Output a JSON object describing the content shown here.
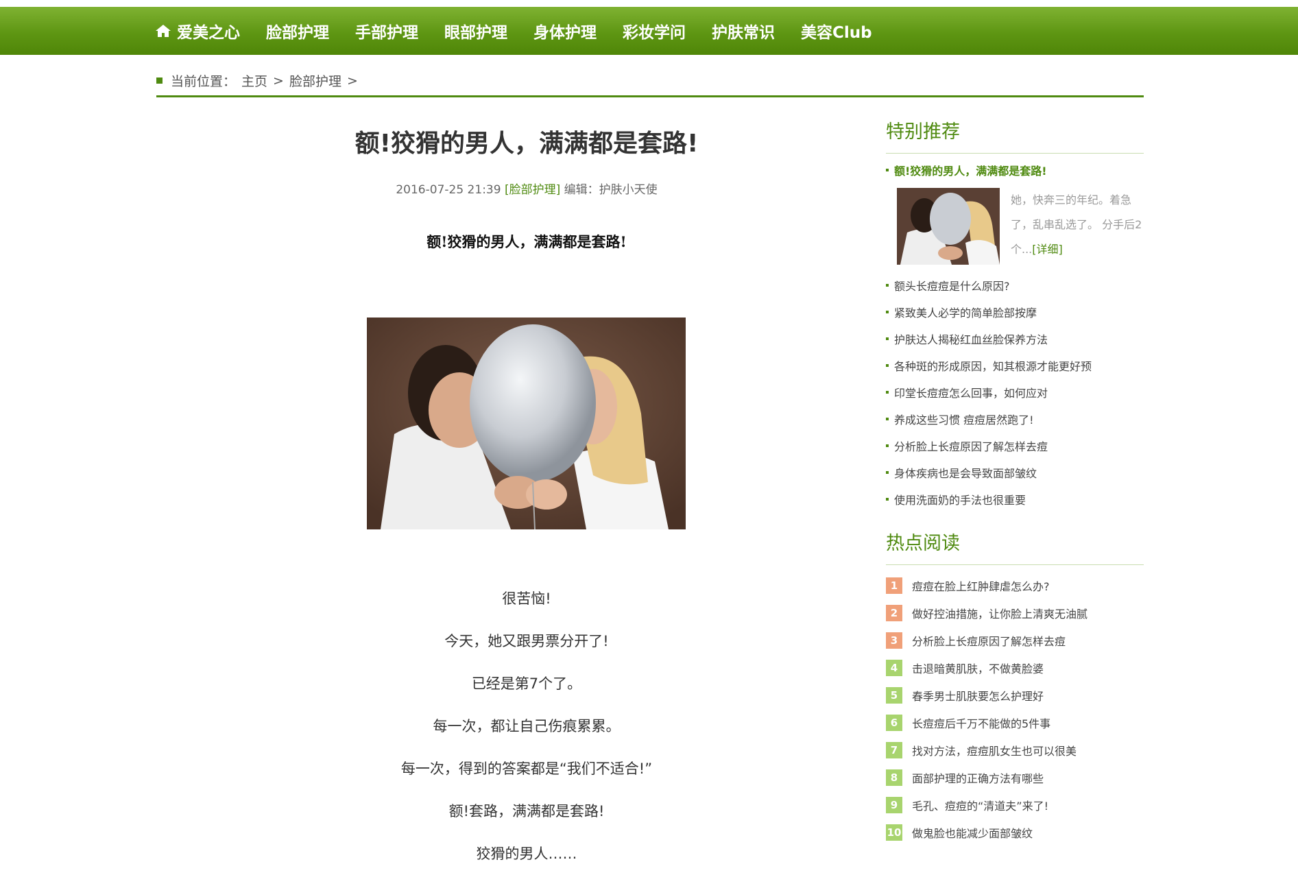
{
  "nav": {
    "home": "爱美之心",
    "items": [
      "脸部护理",
      "手部护理",
      "眼部护理",
      "身体护理",
      "彩妆学问",
      "护肤常识",
      "美容Club"
    ]
  },
  "breadcrumb": {
    "label": "当前位置：",
    "home": "主页",
    "sep1": ">",
    "category": "脸部护理",
    "sep2": ">"
  },
  "article": {
    "title": "额!狡猾的男人，满满都是套路!",
    "datetime": "2016-07-25 21:39",
    "category": "[脸部护理]",
    "editor": "编辑：护肤小天使",
    "subtitle": "额!狡猾的男人，满满都是套路!",
    "paragraphs": [
      "很苦恼!",
      "今天，她又跟男票分开了!",
      "已经是第7个了。",
      "每一次，都让自己伤痕累累。",
      "每一次，得到的答案都是“我们不适合!”",
      "额!套路，满满都是套路!",
      "狡猾的男人……"
    ]
  },
  "recommend": {
    "heading": "特别推荐",
    "featured_title": "额!狡猾的男人，满满都是套路!",
    "featured_desc": "她，快奔三的年纪。着急了，乱串乱选了。 分手后2个...",
    "featured_more": "[详细]",
    "items": [
      "额头长痘痘是什么原因?",
      "紧致美人必学的简单脸部按摩",
      "护肤达人揭秘红血丝脸保养方法",
      "各种斑的形成原因，知其根源才能更好预",
      "印堂长痘痘怎么回事，如何应对",
      "养成这些习惯 痘痘居然跑了!",
      "分析脸上长痘原因了解怎样去痘",
      "身体疾病也是会导致面部皱纹",
      "使用洗面奶的手法也很重要"
    ]
  },
  "hot": {
    "heading": "热点阅读",
    "items": [
      {
        "n": "1",
        "t": "痘痘在脸上红肿肆虐怎么办?"
      },
      {
        "n": "2",
        "t": "做好控油措施，让你脸上清爽无油腻"
      },
      {
        "n": "3",
        "t": "分析脸上长痘原因了解怎样去痘"
      },
      {
        "n": "4",
        "t": "击退暗黄肌肤，不做黄脸婆"
      },
      {
        "n": "5",
        "t": "春季男士肌肤要怎么护理好"
      },
      {
        "n": "6",
        "t": "长痘痘后千万不能做的5件事"
      },
      {
        "n": "7",
        "t": "找对方法，痘痘肌女生也可以很美"
      },
      {
        "n": "8",
        "t": "面部护理的正确方法有哪些"
      },
      {
        "n": "9",
        "t": "毛孔、痘痘的“清道夫”来了!"
      },
      {
        "n": "10",
        "t": "做鬼脸也能减少面部皱纹"
      }
    ]
  },
  "colors": {
    "brand": "#5e9613",
    "rank_top": "#f0a079",
    "rank_rest": "#a8d46e"
  }
}
